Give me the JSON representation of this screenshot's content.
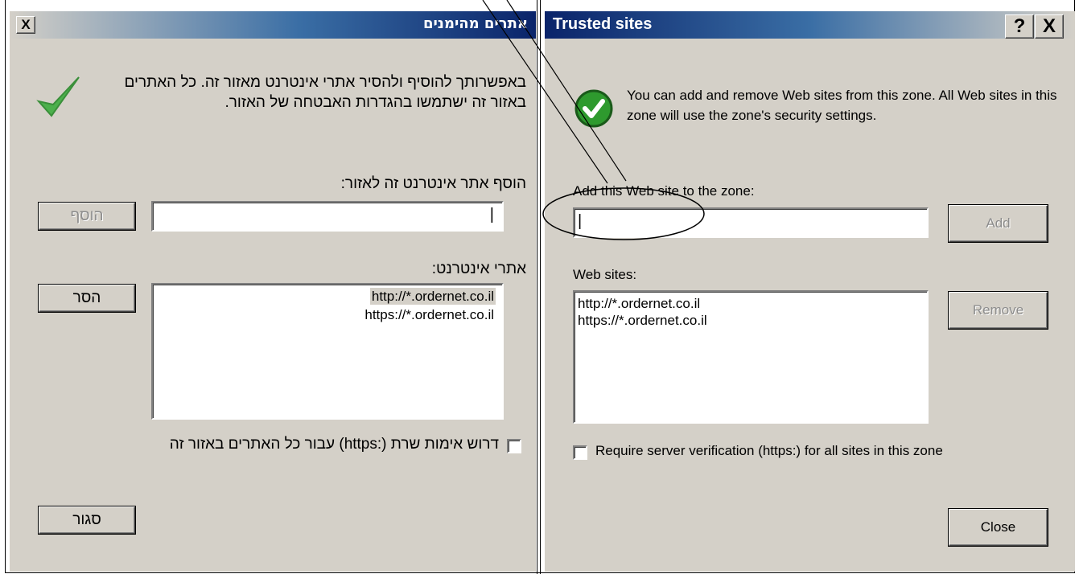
{
  "hebrew_dialog": {
    "title": "אתרים מהימנים",
    "close_glyph": "X",
    "description": "באפשרותך להוסיף ולהסיר אתרי אינטרנט מאזור זה. כל האתרים באזור זה ישתמשו בהגדרות האבטחה של האזור.",
    "add_label": "הוסף אתר אינטרנט זה לאזור:",
    "add_input_value": "|",
    "add_button": "הוסף",
    "sites_label": "אתרי אינטרנט:",
    "sites": [
      "http://*.ordernet.co.il",
      "https://*.ordernet.co.il"
    ],
    "remove_button": "הסר",
    "verify_label": "דרוש אימות שרת (:https) עבור כל האתרים באזור זה",
    "close_button": "סגור"
  },
  "english_dialog": {
    "title": "Trusted sites",
    "help_glyph": "?",
    "close_glyph": "X",
    "description": "You can add and remove Web sites from this zone. All Web sites in this zone will use the zone's security settings.",
    "add_label": "Add this Web site to the zone:",
    "add_input_value": "|",
    "add_button": "Add",
    "sites_label": "Web sites:",
    "sites": [
      "http://*.ordernet.co.il",
      "https://*.ordernet.co.il"
    ],
    "remove_button": "Remove",
    "verify_label": "Require server verification (https:) for all sites in this zone",
    "close_button": "Close"
  },
  "colors": {
    "titlebar_dark": "#0a246a",
    "dialog_face": "#d4d0c8",
    "check_green": "#2e9a2e"
  }
}
